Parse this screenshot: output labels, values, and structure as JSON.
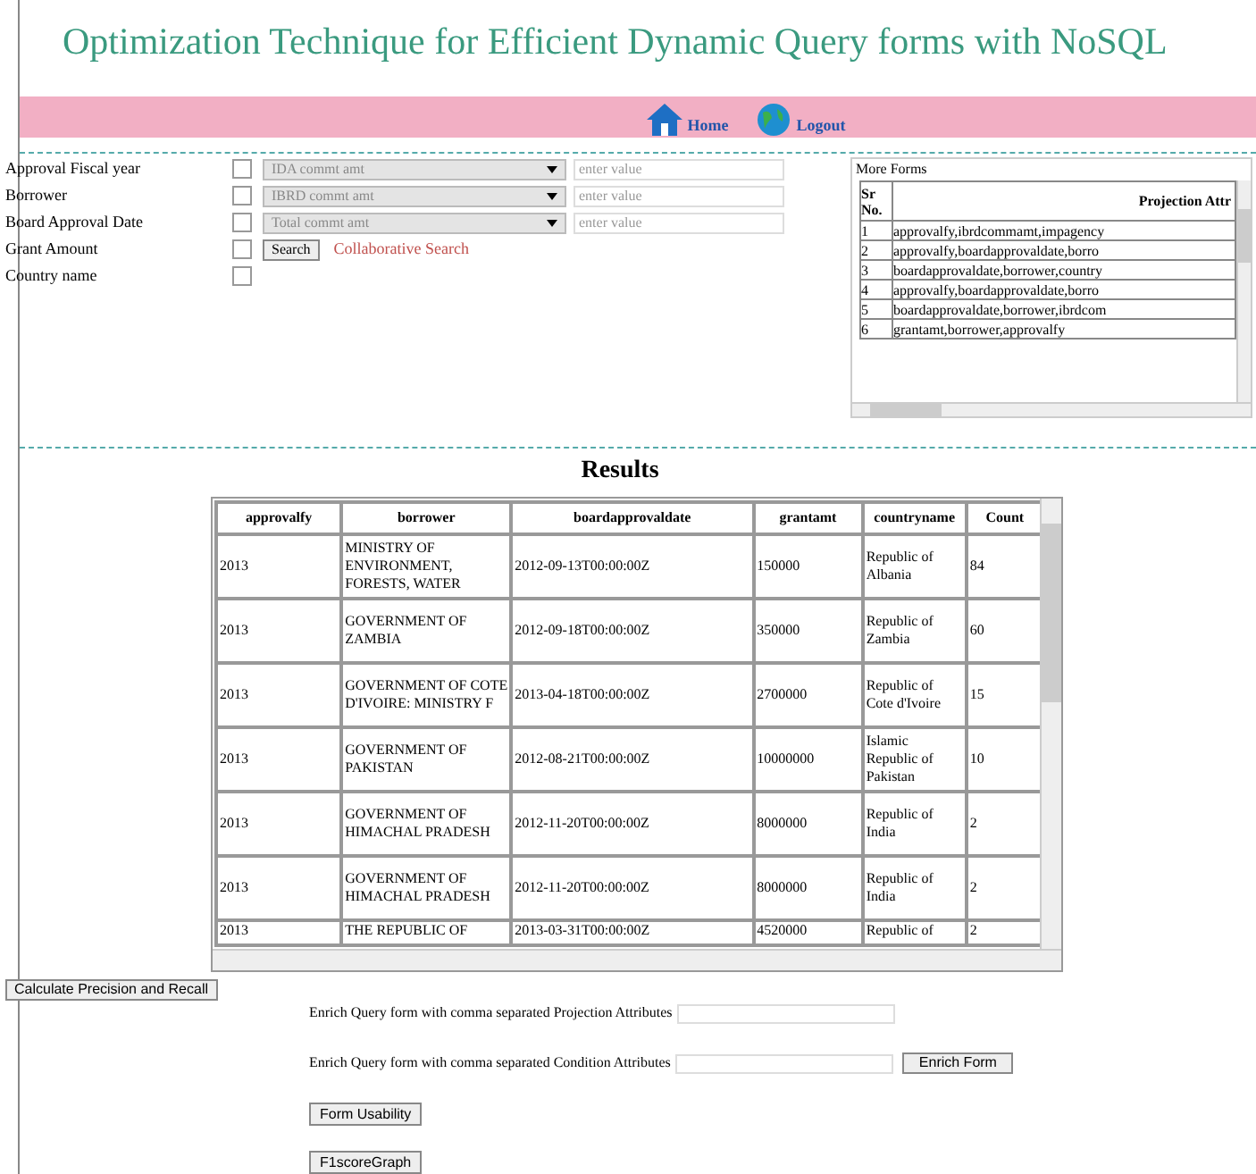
{
  "title": "Optimization Technique for Efficient Dynamic Query forms with NoSQL",
  "nav": [
    {
      "label": "Home"
    },
    {
      "label": "Logout"
    }
  ],
  "form_rows": [
    {
      "label": "Approval Fiscal year",
      "checked": false,
      "select": "IDA commt amt",
      "placeholder": "enter value"
    },
    {
      "label": "Borrower",
      "checked": false,
      "select": "IBRD commt amt",
      "placeholder": "enter value"
    },
    {
      "label": "Board Approval Date",
      "checked": false,
      "select": "Total commt amt",
      "placeholder": "enter value"
    },
    {
      "label": "Grant Amount",
      "checked": false
    },
    {
      "label": "Country name",
      "checked": false
    }
  ],
  "search_button": "Search",
  "collaborative_link": "Collaborative Search",
  "more_forms": {
    "title": "More Forms",
    "columns": [
      "Sr No.",
      "Projection Attr"
    ],
    "rows": [
      [
        "1",
        "approvalfy,ibrdcommamt,impagency"
      ],
      [
        "2",
        "approvalfy,boardapprovaldate,borro"
      ],
      [
        "3",
        "boardapprovaldate,borrower,country"
      ],
      [
        "4",
        "approvalfy,boardapprovaldate,borro"
      ],
      [
        "5",
        "boardapprovaldate,borrower,ibrdcom"
      ],
      [
        "6",
        "grantamt,borrower,approvalfy"
      ]
    ]
  },
  "results": {
    "heading": "Results",
    "columns": [
      "approvalfy",
      "borrower",
      "boardapprovaldate",
      "grantamt",
      "countryname",
      "Count"
    ],
    "rows": [
      [
        "2013",
        "MINISTRY OF ENVIRONMENT, FORESTS, WATER",
        "2012-09-13T00:00:00Z",
        "150000",
        "Republic of Albania",
        "84"
      ],
      [
        "2013",
        "GOVERNMENT OF ZAMBIA",
        "2012-09-18T00:00:00Z",
        "350000",
        "Republic of Zambia",
        "60"
      ],
      [
        "2013",
        "GOVERNMENT OF COTE D'IVOIRE: MINISTRY F",
        "2013-04-18T00:00:00Z",
        "2700000",
        "Republic of Cote d'Ivoire",
        "15"
      ],
      [
        "2013",
        "GOVERNMENT OF PAKISTAN",
        "2012-08-21T00:00:00Z",
        "10000000",
        "Islamic Republic of Pakistan",
        "10"
      ],
      [
        "2013",
        "GOVERNMENT OF HIMACHAL PRADESH",
        "2012-11-20T00:00:00Z",
        "8000000",
        "Republic of India",
        "2"
      ],
      [
        "2013",
        "GOVERNMENT OF HIMACHAL PRADESH",
        "2012-11-20T00:00:00Z",
        "8000000",
        "Republic of India",
        "2"
      ],
      [
        "2013",
        "THE REPUBLIC OF",
        "2013-03-31T00:00:00Z",
        "4520000",
        "Republic of",
        "2"
      ]
    ]
  },
  "precision_button": "Calculate Precision and Recall",
  "enrich_projection_label": "Enrich Query form with comma separated Projection Attributes",
  "enrich_condition_label": "Enrich Query form with comma separated Condition Attributes",
  "enrich_button": "Enrich Form",
  "usability_button": "Form Usability",
  "graph_button": "F1scoreGraph"
}
